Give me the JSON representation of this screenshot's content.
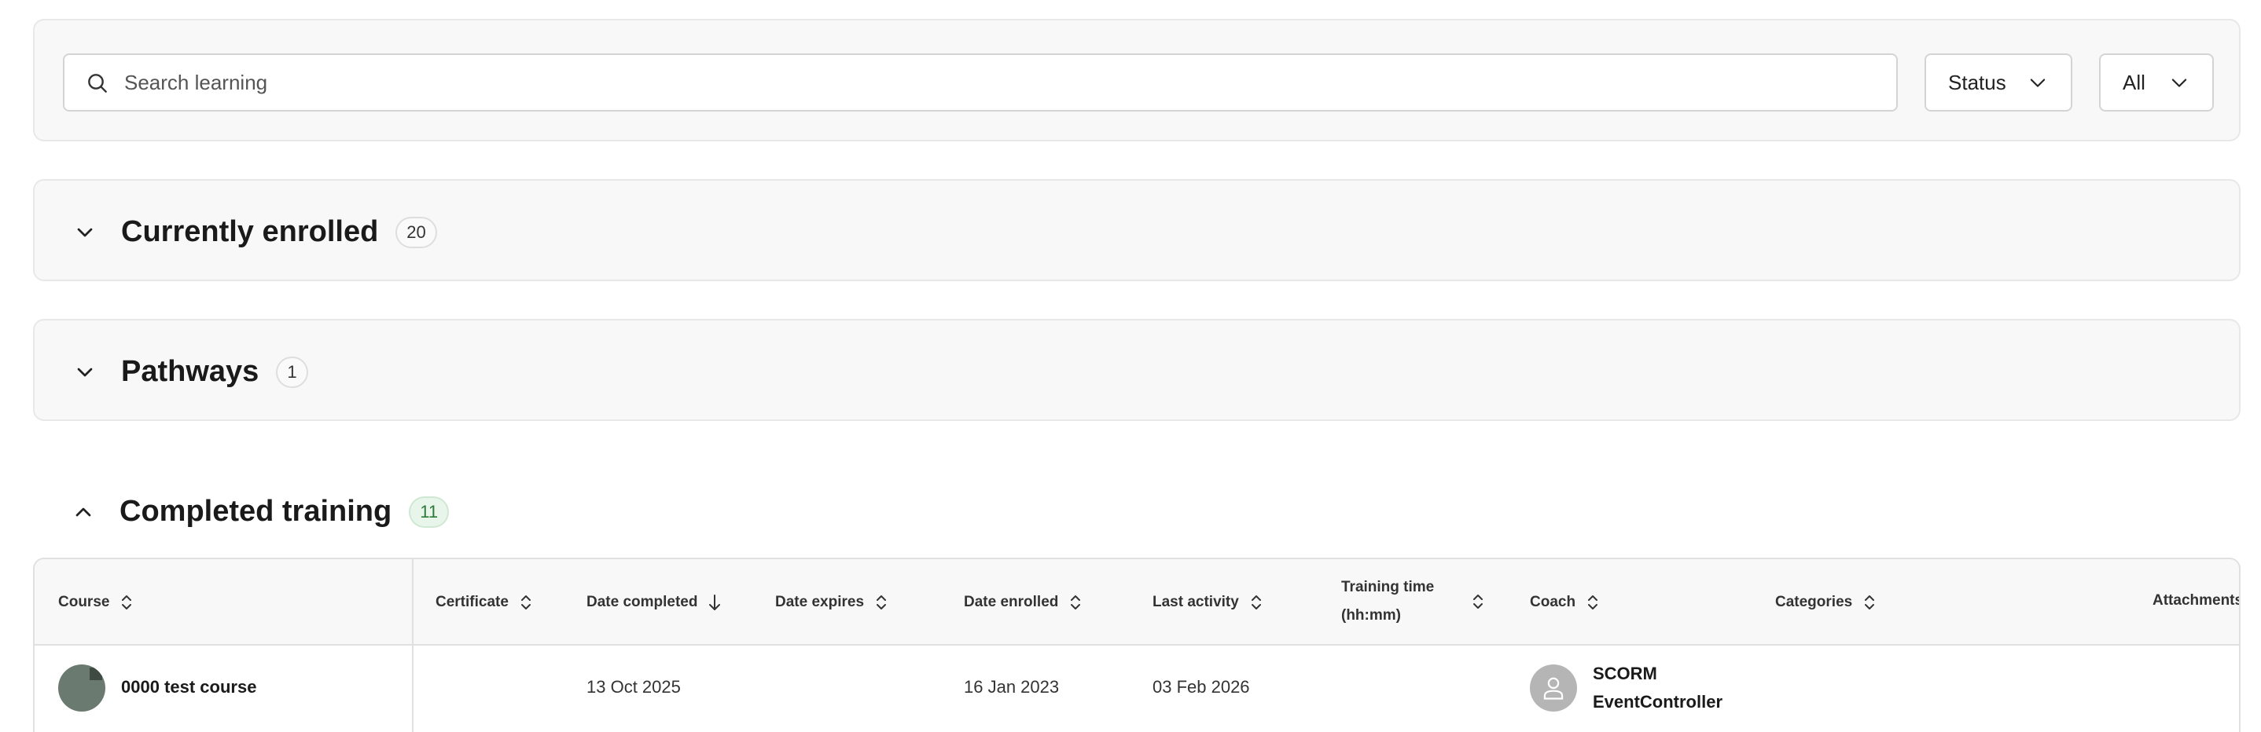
{
  "search": {
    "placeholder": "Search learning"
  },
  "filters": {
    "status_label": "Status",
    "all_label": "All"
  },
  "sections": {
    "enrolled": {
      "title": "Currently enrolled",
      "count": "20"
    },
    "pathways": {
      "title": "Pathways",
      "count": "1"
    },
    "completed": {
      "title": "Completed training",
      "count": "11"
    }
  },
  "table": {
    "headers": {
      "course": "Course",
      "certificate": "Certificate",
      "date_completed": "Date completed",
      "date_expires": "Date expires",
      "date_enrolled": "Date enrolled",
      "last_activity": "Last activity",
      "training_time_1": "Training time",
      "training_time_2": "(hh:mm)",
      "coach": "Coach",
      "categories": "Categories",
      "attachments": "Attachments"
    },
    "rows": [
      {
        "course": "0000 test course",
        "certificate": "",
        "date_completed": "13 Oct 2025",
        "date_expires": "",
        "date_enrolled": "16 Jan 2023",
        "last_activity": "03 Feb 2026",
        "training_time": "",
        "coach_line1": "SCORM",
        "coach_line2": "EventController",
        "categories": "",
        "attachments": ""
      }
    ]
  },
  "colors": {
    "badge_green_bg": "#e8f5ea",
    "badge_green_text": "#2d7a3a",
    "panel_bg": "#f8f8f8"
  }
}
